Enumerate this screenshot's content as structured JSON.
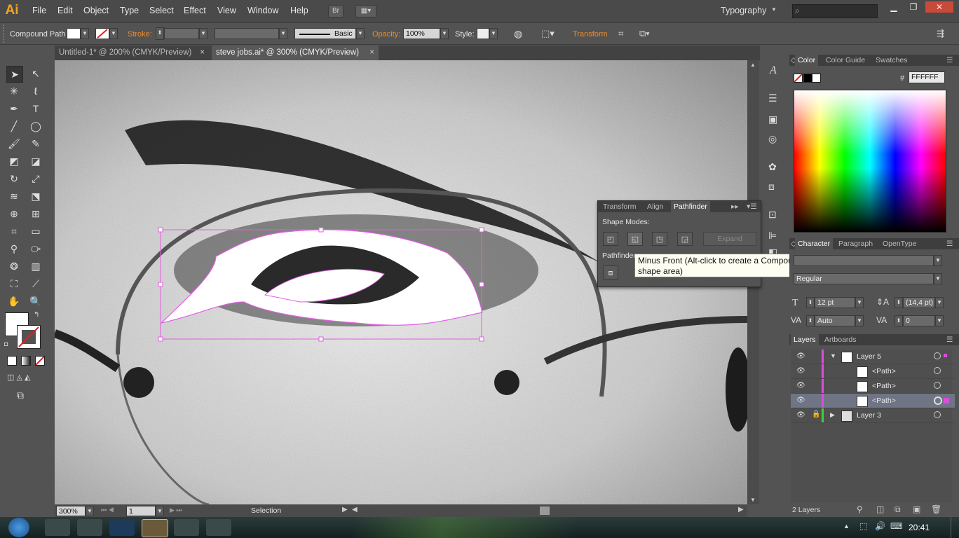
{
  "app": {
    "logo": "Ai"
  },
  "menu": [
    "File",
    "Edit",
    "Object",
    "Type",
    "Select",
    "Effect",
    "View",
    "Window",
    "Help"
  ],
  "menubar_extra": {
    "bridge": "Br",
    "workspace": "Typography"
  },
  "control_bar": {
    "selection_type": "Compound Path",
    "stroke_label": "Stroke:",
    "brush_label": "Basic",
    "opacity_label": "Opacity:",
    "opacity_value": "100%",
    "style_label": "Style:",
    "transform_label": "Transform"
  },
  "doc_tabs": [
    {
      "title": "Untitled-1* @ 200% (CMYK/Preview)",
      "active": false
    },
    {
      "title": "steve jobs.ai* @ 300% (CMYK/Preview)",
      "active": true
    }
  ],
  "status_bar": {
    "zoom": "300%",
    "artboard": "1",
    "tool": "Selection"
  },
  "pathfinder": {
    "tabs": [
      "Transform",
      "Align",
      "Pathfinder"
    ],
    "shape_modes_label": "Shape Modes:",
    "pathfinders_label": "Pathfinder",
    "expand_label": "Expand",
    "tooltip": "Minus Front (Alt-click to create a Compound Shape and subtract from shape area)"
  },
  "color_panel": {
    "tabs": [
      "Color",
      "Color Guide",
      "Swatches"
    ],
    "hex_label": "#",
    "hex_value": "FFFFFF"
  },
  "character_panel": {
    "tabs": [
      "Character",
      "Paragraph",
      "OpenType"
    ],
    "font_style": "Regular",
    "font_size": "12 pt",
    "leading": "(14,4 pt)",
    "kerning": "Auto",
    "tracking": "0"
  },
  "layers_panel": {
    "tabs": [
      "Layers",
      "Artboards"
    ],
    "rows": [
      {
        "name": "Layer 5",
        "indent": 0,
        "selected": false,
        "locked": false,
        "expanded": true
      },
      {
        "name": "<Path>",
        "indent": 1,
        "selected": false,
        "locked": false
      },
      {
        "name": "<Path>",
        "indent": 1,
        "selected": false,
        "locked": false
      },
      {
        "name": "<Path>",
        "indent": 1,
        "selected": true,
        "locked": false
      },
      {
        "name": "Layer 3",
        "indent": 0,
        "selected": false,
        "locked": true,
        "expanded": false
      }
    ],
    "count": "2 Layers"
  },
  "taskbar": {
    "time": "20:41"
  },
  "colors": {
    "accent_orange": "#f08c2a",
    "selection_magenta": "#e35ee3",
    "logo": "#f7a41d"
  }
}
